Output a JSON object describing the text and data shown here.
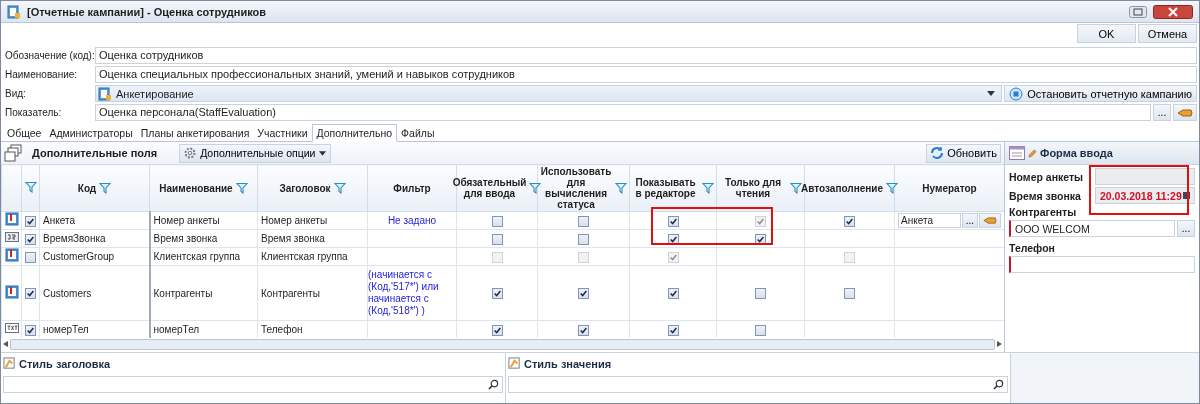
{
  "window": {
    "title": "[Отчетные кампании] - Оценка сотрудников"
  },
  "buttons": [
    {
      "label": "OK"
    },
    {
      "label": "Отмена"
    }
  ],
  "fields": [
    {
      "label": "Обозначение (код):",
      "value": "Оценка сотрудников",
      "kind": "text"
    },
    {
      "label": "Наименование:",
      "value": "Оценка специальных профессиональных знаний, умений и навыков сотрудников",
      "kind": "text"
    },
    {
      "label": "Вид:",
      "value": "Анкетирование",
      "kind": "dropdown",
      "action": "Остановить отчетную кампанию"
    },
    {
      "label": "Показатель:",
      "value": "Оценка персонала(StaffEvaluation)",
      "kind": "lookup",
      "button": "..."
    }
  ],
  "tabs": [
    {
      "label": "Общее",
      "selected": false
    },
    {
      "label": "Администраторы",
      "selected": false
    },
    {
      "label": "Планы анкетирования",
      "selected": false
    },
    {
      "label": "Участники",
      "selected": false
    },
    {
      "label": "Дополнительно",
      "selected": true
    },
    {
      "label": "Файлы",
      "selected": false
    }
  ],
  "grid": {
    "title": "Дополнительные поля",
    "options_button": "Дополнительные опции",
    "refresh_button": "Обновить",
    "check_column_filter": true,
    "columns": [
      {
        "label": "Код",
        "filter": true
      },
      {
        "label": "Наименование",
        "filter": true
      },
      {
        "label": "Заголовок",
        "filter": true
      },
      {
        "label": "Фильтр",
        "filter": false
      },
      {
        "label": "Обязательный для ввода",
        "filter": true
      },
      {
        "label": "Использовать для вычисления статуса",
        "filter": true
      },
      {
        "label": "Показывать в редакторе",
        "filter": true
      },
      {
        "label": "Только для чтения",
        "filter": true
      },
      {
        "label": "Автозаполнение",
        "filter": true
      },
      {
        "label": "Нумератор",
        "filter": false
      }
    ],
    "rows": [
      {
        "kind": "list",
        "enabled": {
          "checked": true,
          "disabled": false
        },
        "code": "Анкета",
        "name": "Номер анкеты",
        "caption": "Номер анкеты",
        "filter": "Не задано",
        "required": {
          "checked": false,
          "disabled": false
        },
        "status": {
          "checked": false,
          "disabled": false
        },
        "show": {
          "checked": true,
          "disabled": false
        },
        "readonly": {
          "checked": true,
          "disabled": true
        },
        "autofill": {
          "checked": true,
          "disabled": false
        },
        "numerator": {
          "value": "Анкета",
          "button": "..."
        }
      },
      {
        "kind": "datetime",
        "enabled": {
          "checked": true,
          "disabled": false
        },
        "code": "ВремяЗвонка",
        "name": "Время звонка",
        "caption": "Время звонка",
        "required": {
          "checked": false,
          "disabled": false
        },
        "status": {
          "checked": false,
          "disabled": false
        },
        "show": {
          "checked": true,
          "disabled": false
        },
        "readonly": {
          "checked": true,
          "disabled": false
        }
      },
      {
        "kind": "list",
        "enabled": {
          "checked": false,
          "disabled": false
        },
        "code": "CustomerGroup",
        "name": "Клиентская группа",
        "caption": "Клиентская группа",
        "required": {
          "checked": false,
          "disabled": true
        },
        "status": {
          "checked": false,
          "disabled": true
        },
        "show": {
          "checked": true,
          "disabled": true
        },
        "autofill": {
          "checked": false,
          "disabled": true
        }
      },
      {
        "kind": "list",
        "enabled": {
          "checked": true,
          "disabled": false
        },
        "code": "Customers",
        "name": "Контрагенты",
        "caption": "Контрагенты",
        "filter": "(начинается с (Код,'517*')   или начинается с (Код,'518*') )",
        "required": {
          "checked": true,
          "disabled": false
        },
        "status": {
          "checked": true,
          "disabled": false
        },
        "show": {
          "checked": true,
          "disabled": false
        },
        "readonly": {
          "checked": false,
          "disabled": false
        },
        "autofill": {
          "checked": false,
          "disabled": false
        }
      },
      {
        "kind": "text",
        "enabled": {
          "checked": true,
          "disabled": false
        },
        "code": "номерТел",
        "name": "номерТел",
        "caption": "Телефон",
        "required": {
          "checked": true,
          "disabled": false
        },
        "status": {
          "checked": true,
          "disabled": false
        },
        "show": {
          "checked": true,
          "disabled": false
        },
        "readonly": {
          "checked": false,
          "disabled": false
        }
      }
    ]
  },
  "form": {
    "title": "Форма ввода",
    "fields": [
      {
        "label": "Номер анкеты",
        "kind": "readonly",
        "required": false
      },
      {
        "label": "Время звонка",
        "value": "20.03.2018 11:29",
        "kind": "datetime",
        "required": false
      },
      {
        "label": "Контрагенты",
        "value": "ООО WELCOM",
        "kind": "lookup",
        "required": true,
        "button": "..."
      },
      {
        "label": "Телефон",
        "kind": "text",
        "required": true
      }
    ]
  },
  "style_panels": [
    {
      "title": "Стиль заголовка"
    },
    {
      "title": "Стиль значения"
    }
  ]
}
